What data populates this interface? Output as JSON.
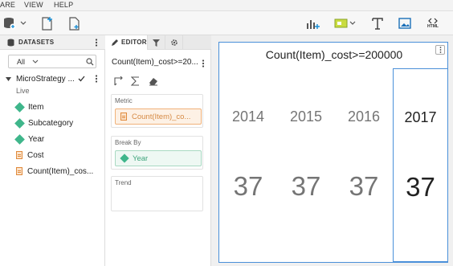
{
  "menu": {
    "items": [
      "ARE",
      "VIEW",
      "HELP"
    ]
  },
  "datasets": {
    "title": "DATASETS",
    "filter_value": "All",
    "dataset_name": "MicroStrategy ...",
    "dataset_status": "Live",
    "objects": [
      {
        "label": "Item",
        "kind": "attribute"
      },
      {
        "label": "Subcategory",
        "kind": "attribute"
      },
      {
        "label": "Year",
        "kind": "attribute"
      },
      {
        "label": "Cost",
        "kind": "metric"
      },
      {
        "label": "Count(Item)_cos...",
        "kind": "metric"
      }
    ]
  },
  "editor": {
    "tab_label": "EDITOR",
    "viz_title": "Count(Item)_cost>=20...",
    "metric_zone": {
      "label": "Metric",
      "chip": "Count(Item)_co..."
    },
    "breakby_zone": {
      "label": "Break By",
      "chip": "Year"
    },
    "trend_zone": {
      "label": "Trend"
    }
  },
  "toolbar": {
    "html_label": "HTML"
  },
  "visualization": {
    "title": "Count(Item)_cost>=200000",
    "columns": [
      {
        "year": "2014",
        "value": "37",
        "selected": false
      },
      {
        "year": "2015",
        "value": "37",
        "selected": false
      },
      {
        "year": "2016",
        "value": "37",
        "selected": false
      },
      {
        "year": "2017",
        "value": "37",
        "selected": true
      }
    ]
  },
  "colors": {
    "accent": "#4a90d9",
    "attribute": "#3fb68b",
    "metric": "#e08a3b"
  }
}
